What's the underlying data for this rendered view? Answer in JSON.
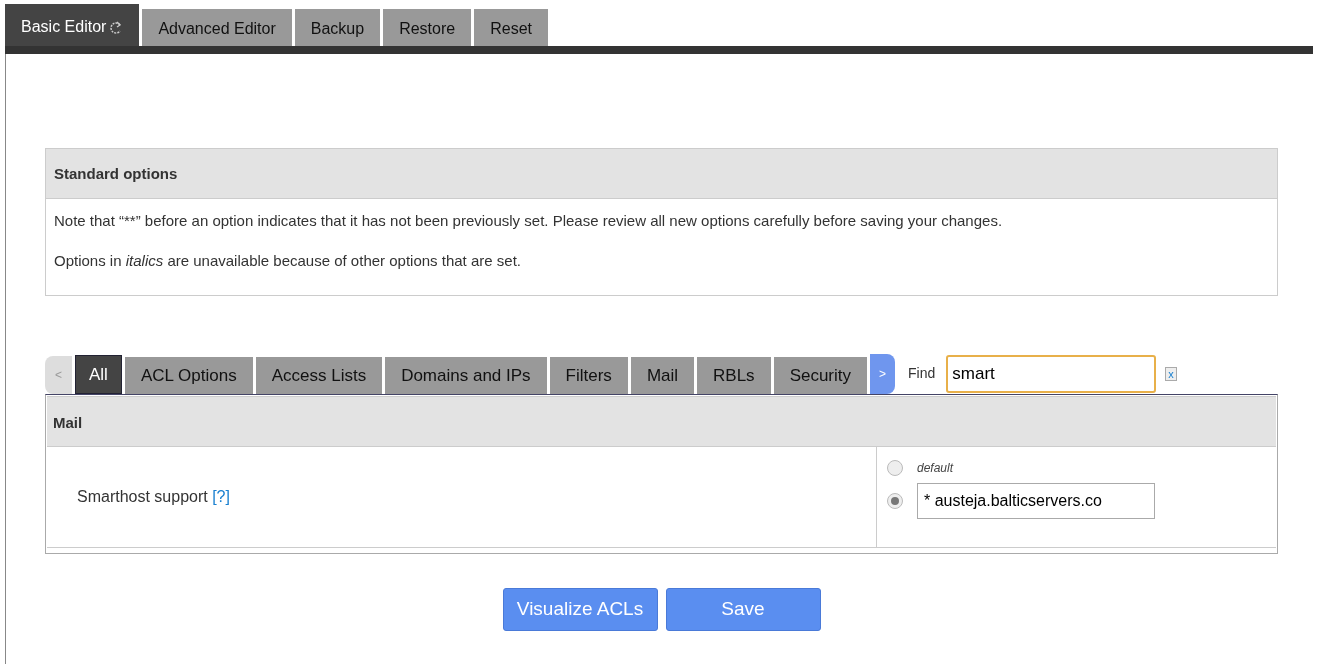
{
  "top_tabs": [
    {
      "label": "Basic Editor",
      "selected": true,
      "icon": true
    },
    {
      "label": "Advanced Editor",
      "selected": false
    },
    {
      "label": "Backup",
      "selected": false
    },
    {
      "label": "Restore",
      "selected": false
    },
    {
      "label": "Reset",
      "selected": false
    }
  ],
  "standard_options": {
    "title": "Standard options",
    "notes": [
      "Note that “**” before an option indicates that it has not been previously set. Please review all new options carefully before saving your changes.",
      "Options in *italics* are unavailable because of other options that are set."
    ]
  },
  "category_tabs": {
    "prev": "<",
    "next": ">",
    "tabs": [
      {
        "label": "All",
        "selected": true
      },
      {
        "label": "ACL Options",
        "selected": false
      },
      {
        "label": "Access Lists",
        "selected": false
      },
      {
        "label": "Domains and IPs",
        "selected": false
      },
      {
        "label": "Filters",
        "selected": false
      },
      {
        "label": "Mail",
        "selected": false
      },
      {
        "label": "RBLs",
        "selected": false
      },
      {
        "label": "Security",
        "selected": false
      }
    ],
    "find": {
      "label": "Find",
      "value": "smart",
      "clear": "x"
    }
  },
  "section": {
    "title": "Mail",
    "options": [
      {
        "label": "Smarthost support",
        "help": "[?]",
        "choices": [
          {
            "kind": "default",
            "label": "default",
            "selected": false
          },
          {
            "kind": "value",
            "value": "* austeja.balticservers.co",
            "selected": true
          }
        ]
      }
    ]
  },
  "buttons": [
    "Visualize ACLs",
    "Save"
  ]
}
